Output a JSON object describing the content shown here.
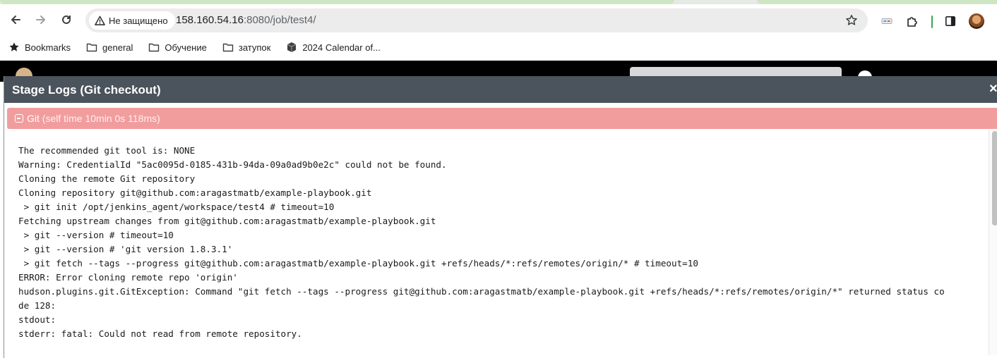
{
  "browser": {
    "security_label": "Не защищено",
    "url_host": "158.160.54.16",
    "url_rest": ":8080/job/test4/"
  },
  "bookmarks": [
    {
      "label": "Bookmarks",
      "icon": "star-icon"
    },
    {
      "label": "general",
      "icon": "folder-icon"
    },
    {
      "label": "Обучение",
      "icon": "folder-icon"
    },
    {
      "label": "затупок",
      "icon": "folder-icon"
    },
    {
      "label": "2024 Calendar of...",
      "icon": "cube-icon"
    }
  ],
  "modal": {
    "title": "Stage Logs (Git checkout)",
    "close": "×",
    "step": {
      "name": "Git",
      "time": "(self time 10min 0s 118ms)",
      "status_color": "#f19d9e"
    },
    "log_lines": [
      "The recommended git tool is: NONE",
      "Warning: CredentialId \"5ac0095d-0185-431b-94da-09a0ad9b0e2c\" could not be found.",
      "Cloning the remote Git repository",
      "Cloning repository git@github.com:aragastmatb/example-playbook.git",
      " > git init /opt/jenkins_agent/workspace/test4 # timeout=10",
      "Fetching upstream changes from git@github.com:aragastmatb/example-playbook.git",
      " > git --version # timeout=10",
      " > git --version # 'git version 1.8.3.1'",
      " > git fetch --tags --progress git@github.com:aragastmatb/example-playbook.git +refs/heads/*:refs/remotes/origin/* # timeout=10",
      "ERROR: Error cloning remote repo 'origin'",
      "hudson.plugins.git.GitException: Command \"git fetch --tags --progress git@github.com:aragastmatb/example-playbook.git +refs/heads/*:refs/remotes/origin/*\" returned status co",
      "de 128:",
      "stdout:",
      "stderr: fatal: Could not read from remote repository."
    ]
  }
}
